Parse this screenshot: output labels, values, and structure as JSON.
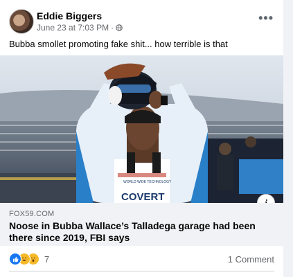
{
  "post": {
    "author": "Eddie Biggers",
    "timestamp": "June 23 at 7:03 PM",
    "separator": "·",
    "caption": "Bubba smollet promoting fake shit... how terrible is that",
    "more_label": "•••"
  },
  "link": {
    "domain": "FOX59.COM",
    "headline": "Noose in Bubba Wallace’s Talladega garage had been there since 2019, FBI says",
    "info_label": "i",
    "image_text": {
      "suit_brand": "COVERT",
      "chest_sponsor": "WORLD WIDE TECHNOLOGY"
    }
  },
  "footer": {
    "reaction_count": "7",
    "comments": "1 Comment",
    "reaction_icons": [
      "like-icon",
      "haha-icon",
      "wow-icon"
    ]
  },
  "colors": {
    "accent": "#1877f2",
    "secondary_text": "#65676b",
    "link_bg": "#f0f2f5"
  }
}
